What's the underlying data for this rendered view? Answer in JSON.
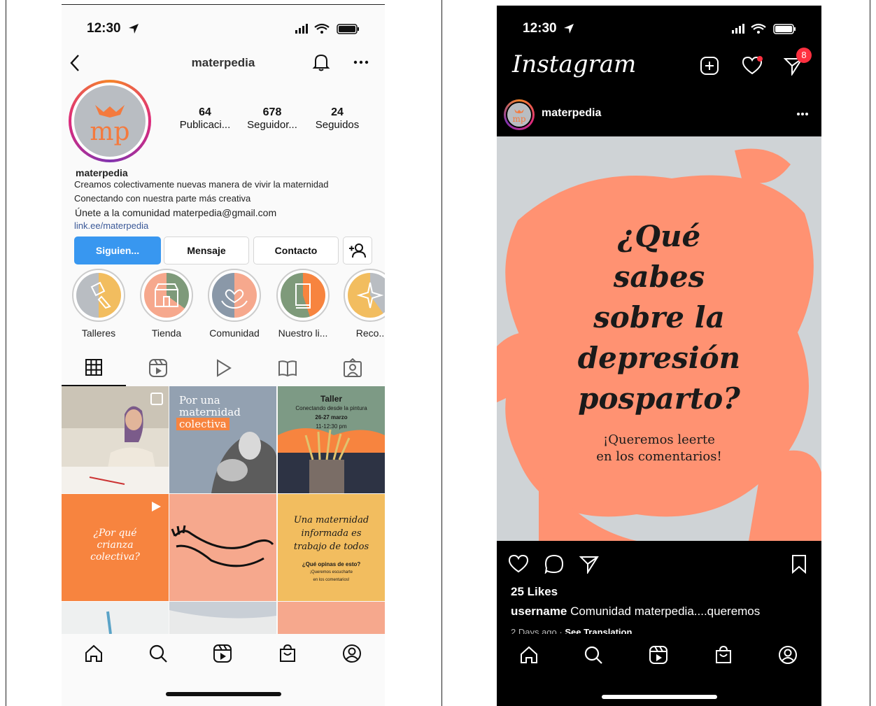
{
  "left": {
    "status_time": "12:30",
    "username": "materpedia",
    "stats": [
      {
        "value": "64",
        "label": "Publicaci..."
      },
      {
        "value": "678",
        "label": "Seguidor..."
      },
      {
        "value": "24",
        "label": "Seguidos"
      }
    ],
    "bio": {
      "name": "materpedia",
      "line1": "Creamos colectivamente nuevas manera de vivir la maternidad",
      "line2": "Conectando con nuestra parte más creativa",
      "line3": "Únete a la comunidad materpedia@gmail.com",
      "link": "link.ee/materpedia"
    },
    "buttons": {
      "following": "Siguien...",
      "message": "Mensaje",
      "contact": "Contacto"
    },
    "highlights": [
      "Talleres",
      "Tienda",
      "Comunidad",
      "Nuestro li...",
      "Reco.."
    ],
    "grid": {
      "post2_line1": "Por una",
      "post2_line2": "maternidad",
      "post2_line3": "colectiva",
      "post3_title": "Taller",
      "post3_sub": "Conectando desde la pintura",
      "post3_date": "26-27 marzo",
      "post3_time": "11-12:30 pm",
      "post4_line1": "¿Por qué",
      "post4_line2": "crianza",
      "post4_line3": "colectiva?",
      "post6_line1": "Una maternidad",
      "post6_line2": "informada es",
      "post6_line3": "trabajo de todos",
      "post6_q": "¿Qué opinas de esto?",
      "post6_small1": "¡Queremos escucharte",
      "post6_small2": "en los comentarios!"
    },
    "colors": {
      "accent_blue": "#3897f0",
      "orange": "#f7843f",
      "salmon": "#f6a88d",
      "yellow": "#f2bd5f"
    }
  },
  "right": {
    "status_time": "12:30",
    "logo": "Instagram",
    "notification_count": "8",
    "account": "materpedia",
    "post_text": {
      "l1": "¿Qué",
      "l2": "sabes",
      "l3": "sobre la",
      "l4": "depresión",
      "l5": "posparto?",
      "s1": "¡Queremos leerte",
      "s2": "en los comentarios!"
    },
    "likes": "25 Likes",
    "caption_user": "username",
    "caption_text": "Comunidad materpedia....queremos",
    "time_ago": "2 Days ago · ",
    "see_translation": "See Translation"
  }
}
